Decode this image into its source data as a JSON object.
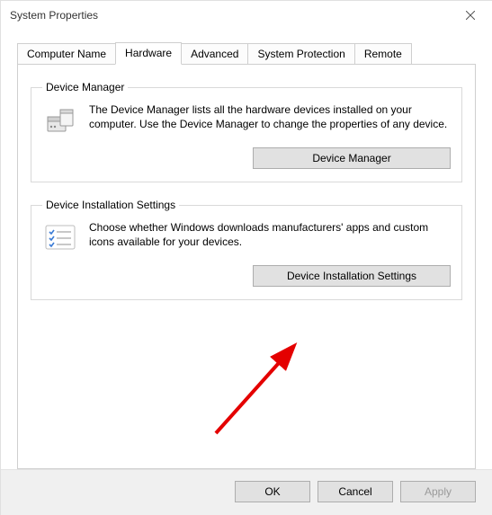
{
  "window": {
    "title": "System Properties"
  },
  "tabs": {
    "computer_name": "Computer Name",
    "hardware": "Hardware",
    "advanced": "Advanced",
    "system_protection": "System Protection",
    "remote": "Remote"
  },
  "device_manager": {
    "legend": "Device Manager",
    "description": "The Device Manager lists all the hardware devices installed on your computer. Use the Device Manager to change the properties of any device.",
    "button": "Device Manager"
  },
  "device_install": {
    "legend": "Device Installation Settings",
    "description": "Choose whether Windows downloads manufacturers' apps and custom icons available for your devices.",
    "button": "Device Installation Settings"
  },
  "buttons": {
    "ok": "OK",
    "cancel": "Cancel",
    "apply": "Apply"
  }
}
